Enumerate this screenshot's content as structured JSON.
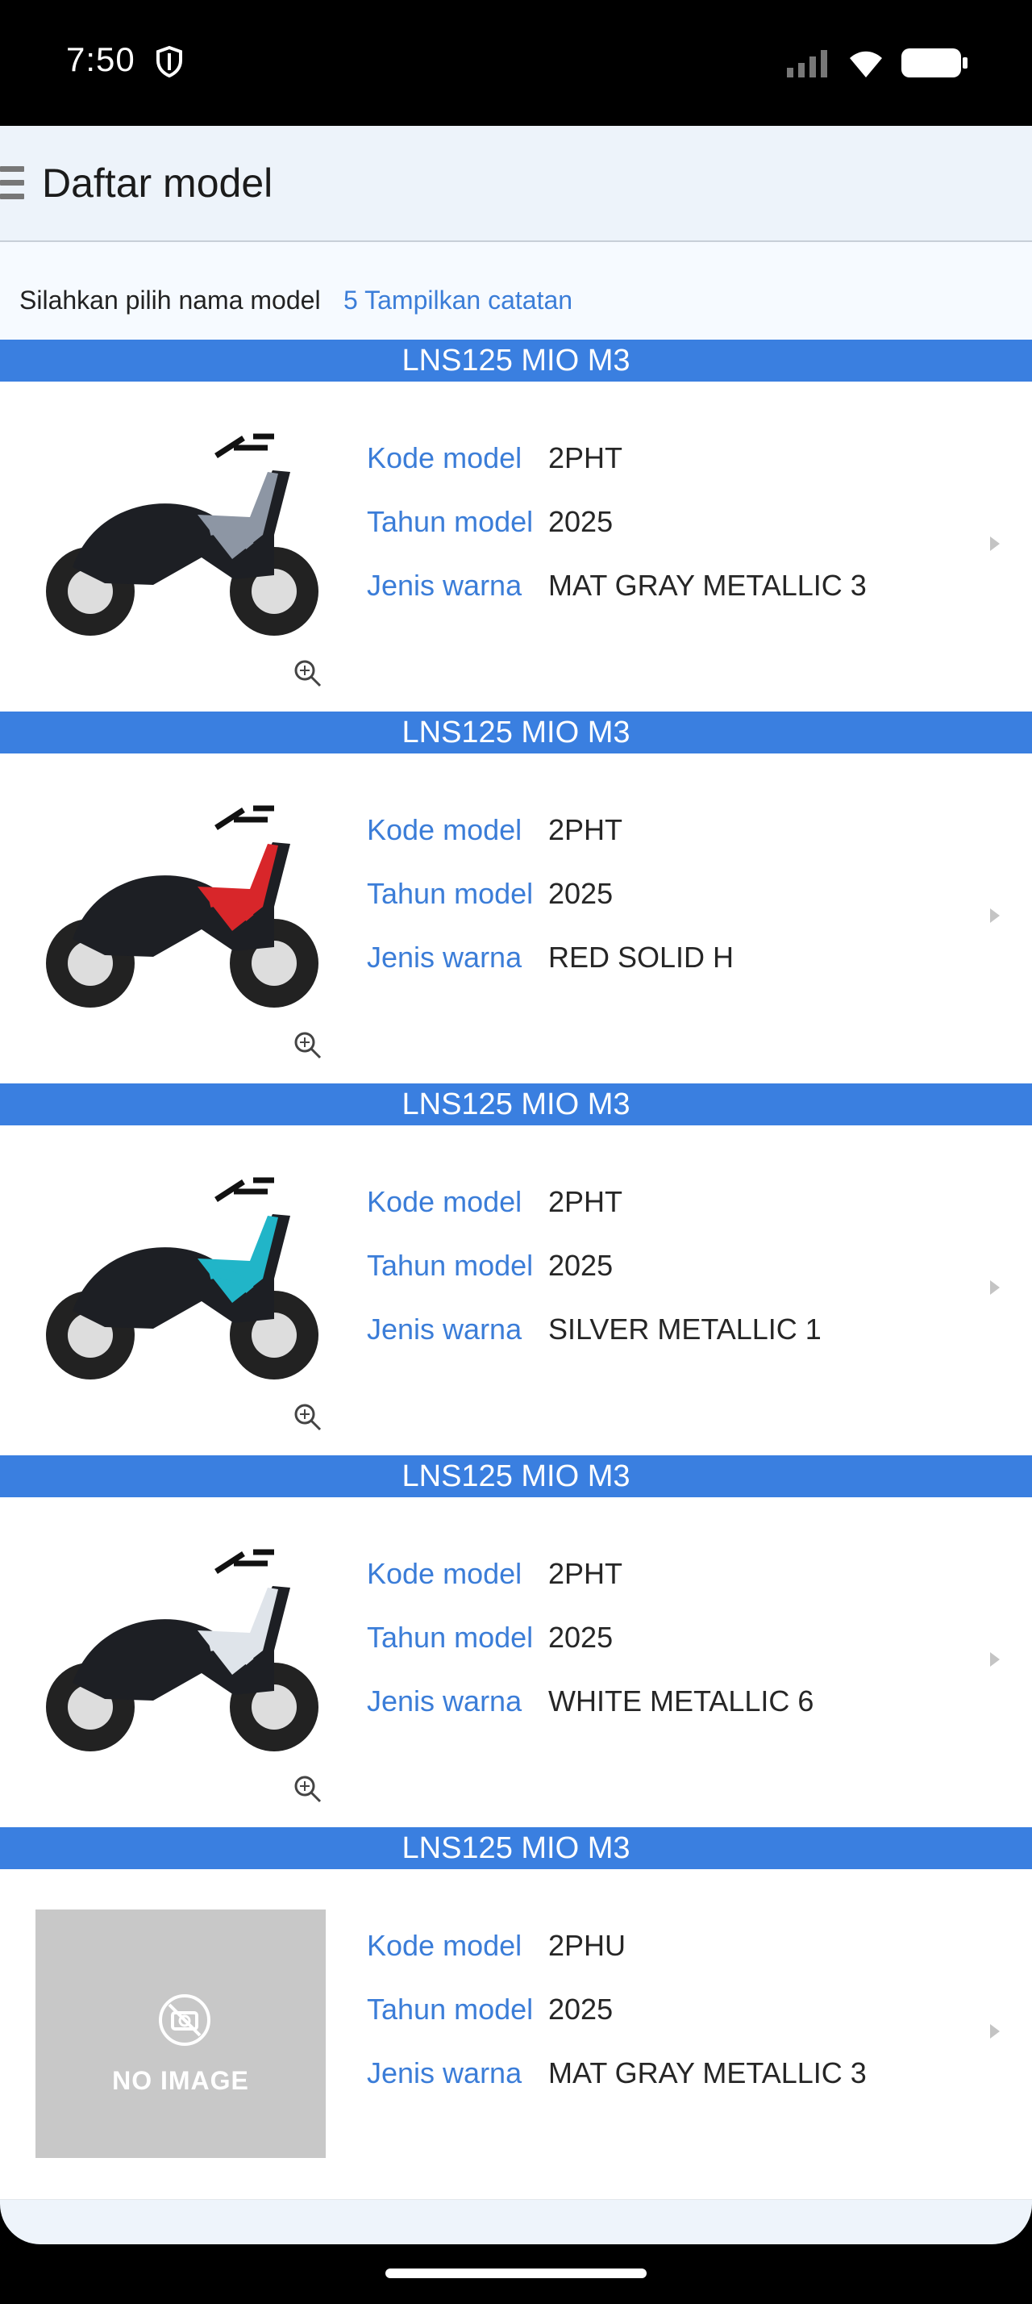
{
  "status": {
    "time": "7:50"
  },
  "header": {
    "title": "Daftar model"
  },
  "subbar": {
    "label": "Silahkan pilih nama model",
    "link": "5 Tampilkan catatan"
  },
  "labels": {
    "code": "Kode model",
    "year": "Tahun model",
    "color": "Jenis warna"
  },
  "models": [
    {
      "name": "LNS125 MIO M3",
      "code": "2PHT",
      "year": "2025",
      "color": "MAT GRAY METALLIC 3",
      "accent": "#8d96a4",
      "image": "scooter-gray"
    },
    {
      "name": "LNS125 MIO M3",
      "code": "2PHT",
      "year": "2025",
      "color": "RED SOLID H",
      "accent": "#d8262a",
      "image": "scooter-red"
    },
    {
      "name": "LNS125 MIO M3",
      "code": "2PHT",
      "year": "2025",
      "color": "SILVER METALLIC 1",
      "accent": "#21b5c8",
      "image": "scooter-teal"
    },
    {
      "name": "LNS125 MIO M3",
      "code": "2PHT",
      "year": "2025",
      "color": "WHITE METALLIC 6",
      "accent": "#dfe4ea",
      "image": "scooter-white"
    },
    {
      "name": "LNS125 MIO M3",
      "code": "2PHU",
      "year": "2025",
      "color": "MAT GRAY METALLIC 3",
      "image": "no-image",
      "no_image_text": "NO IMAGE"
    }
  ],
  "colors": {
    "accent_blue": "#3a7fe0",
    "link_blue": "#3b7dd8"
  }
}
